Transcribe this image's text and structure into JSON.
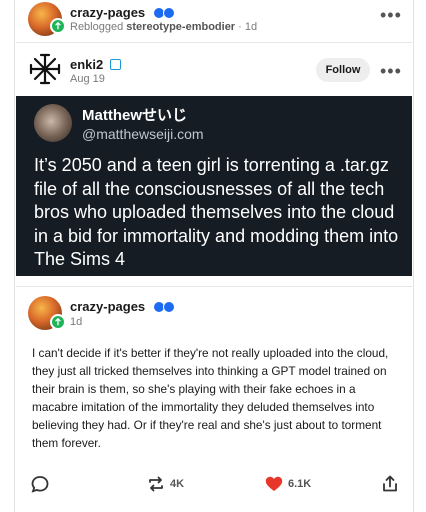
{
  "reblog": {
    "username": "crazy-pages",
    "reblog_prefix": "Reblogged",
    "reblog_source": "stereotype-embodier",
    "time": "1d"
  },
  "original": {
    "username": "enki2",
    "date": "Aug 19",
    "follow_label": "Follow"
  },
  "tweet": {
    "name": "Matthewせいじ",
    "handle": "@matthewseiji.com",
    "text": "It’s 2050 and a teen girl is torrenting a .tar.gz file of all the consciousnesses of all the tech bros who uploaded themselves into the cloud in a bid for immortality and modding them into The Sims 4"
  },
  "reply": {
    "username": "crazy-pages",
    "time": "1d",
    "text": "I can't decide if it's better if they're not really uploaded into the cloud, they just all tricked themselves into thinking a GPT model trained on their brain is them, so she's playing with their fake echoes in a macabre imitation of the immortality they deluded themselves into believing they had. Or if they're real and she's just about to torment them forever."
  },
  "actions": {
    "reblogs": "4K",
    "likes": "6.1K"
  },
  "colors": {
    "like": "#e8362a",
    "verified": "#1d6bf3",
    "badge": "#1fb45a",
    "tweet_bg": "#161c23"
  },
  "icons": [
    "reblog-badge-icon",
    "more-options-icon",
    "verified-icon",
    "asterisk-avatar-icon",
    "comment-icon",
    "reblog-icon",
    "heart-icon",
    "share-icon"
  ]
}
